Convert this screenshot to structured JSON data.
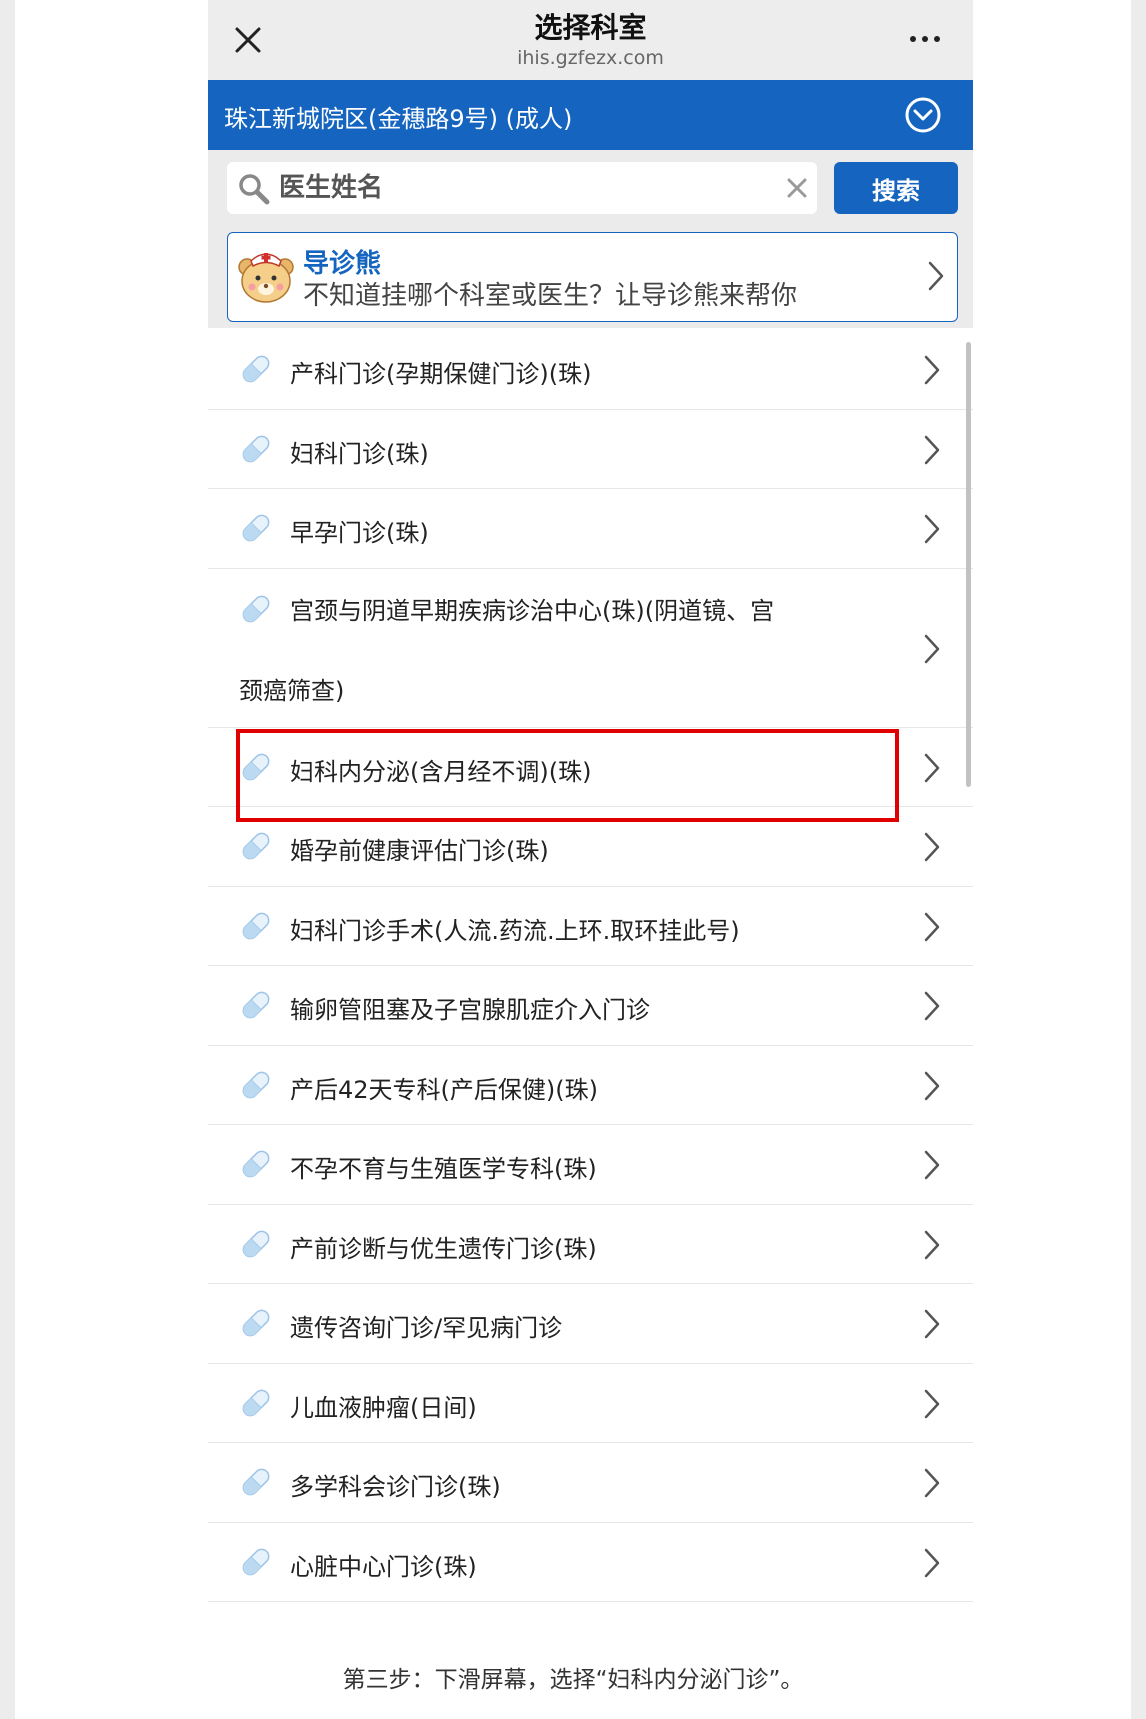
{
  "header": {
    "title": "选择科室",
    "domain": "ihis.gzfezx.com"
  },
  "campus": {
    "label": "珠江新城院区(金穗路9号) (成人)"
  },
  "search": {
    "placeholder": "医生姓名",
    "button_label": "搜索"
  },
  "guide": {
    "title": "导诊熊",
    "subtitle": "不知道挂哪个科室或医生？让导诊熊来帮你"
  },
  "departments": [
    {
      "label": "产科门诊(孕期保健门诊)(珠)"
    },
    {
      "label": "妇科门诊(珠)"
    },
    {
      "label": "早孕门诊(珠)"
    },
    {
      "label": "宫颈与阴道早期疾病诊治中心(珠)(阴道镜、宫",
      "label2": "颈癌筛查)"
    },
    {
      "label": "妇科内分泌(含月经不调)(珠)"
    },
    {
      "label": "婚孕前健康评估门诊(珠)"
    },
    {
      "label": "妇科门诊手术(人流.药流.上环.取环挂此号)"
    },
    {
      "label": "输卵管阻塞及子宫腺肌症介入门诊"
    },
    {
      "label": "产后42天专科(产后保健)(珠)"
    },
    {
      "label": "不孕不育与生殖医学专科(珠)"
    },
    {
      "label": "产前诊断与优生遗传门诊(珠)"
    },
    {
      "label": "遗传咨询门诊/罕见病门诊"
    },
    {
      "label": "儿血液肿瘤(日间)"
    },
    {
      "label": "多学科会诊门诊(珠)"
    },
    {
      "label": "心脏中心门诊(珠)"
    }
  ],
  "caption": "第三步：下滑屏幕，选择“妇科内分泌门诊”。",
  "colors": {
    "primary": "#1565c0",
    "highlight": "#e00000"
  }
}
